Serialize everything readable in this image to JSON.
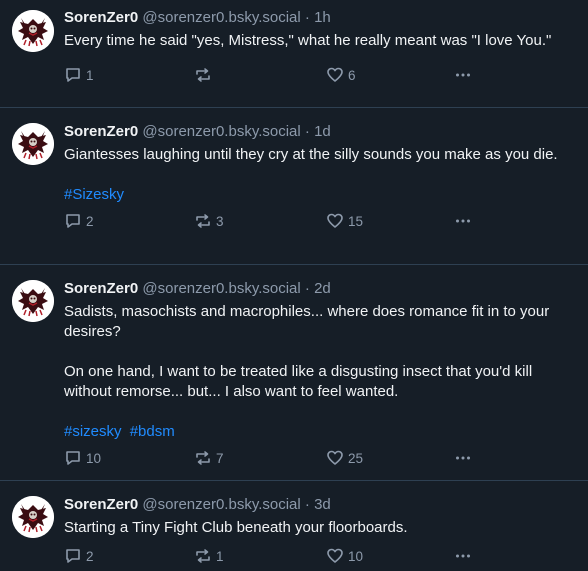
{
  "posts": [
    {
      "display_name": "SorenZer0",
      "handle": "@sorenzer0.bsky.social",
      "separator": "·",
      "time": "1h",
      "paragraphs": [
        "Every time he said \"yes, Mistress,\" what he really meant was \"I love You.\""
      ],
      "tags": [],
      "reply_count": "1",
      "repost_count": "",
      "like_count": "6"
    },
    {
      "display_name": "SorenZer0",
      "handle": "@sorenzer0.bsky.social",
      "separator": "·",
      "time": "1d",
      "paragraphs": [
        "Giantesses laughing until they cry at the silly sounds you make as you die."
      ],
      "tags": [
        "#Sizesky"
      ],
      "reply_count": "2",
      "repost_count": "3",
      "like_count": "15"
    },
    {
      "display_name": "SorenZer0",
      "handle": "@sorenzer0.bsky.social",
      "separator": "·",
      "time": "2d",
      "paragraphs": [
        "Sadists, masochists and macrophiles... where does romance fit in to your desires?",
        "On one hand, I want to be treated like a disgusting insect that you'd kill without remorse... but... I also want to feel wanted."
      ],
      "tags": [
        "#sizesky",
        "#bdsm"
      ],
      "reply_count": "10",
      "repost_count": "7",
      "like_count": "25"
    },
    {
      "display_name": "SorenZer0",
      "handle": "@sorenzer0.bsky.social",
      "separator": "·",
      "time": "3d",
      "paragraphs": [
        "Starting a Tiny Fight Club beneath your floorboards."
      ],
      "tags": [],
      "reply_count": "2",
      "repost_count": "1",
      "like_count": "10"
    }
  ],
  "icons": {
    "reply": "speech-bubble-icon",
    "repost": "repost-arrows-icon",
    "like": "heart-icon",
    "more": "ellipsis-icon"
  },
  "colors": {
    "background": "#161e27",
    "divider": "#2e4052",
    "text": "#f1f3f5",
    "muted": "#8d9aab",
    "link": "#208bfe"
  }
}
